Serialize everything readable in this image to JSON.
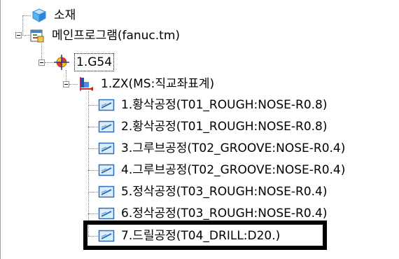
{
  "tree": {
    "material": {
      "label": "소재",
      "icon": "material-cube-icon"
    },
    "main_program": {
      "label": "메인프로그램(fanuc.tm)",
      "icon": "program-icon"
    },
    "workpiece_origin": {
      "label": "1.G54",
      "icon": "origin-target-icon"
    },
    "coordinate_system": {
      "label": "1.ZX(MS:직교좌표계)",
      "icon": "coordinate-system-icon"
    },
    "operations": [
      {
        "label": "1.황삭공정(T01_ROUGH:NOSE-R0.8)",
        "icon": "operation-icon"
      },
      {
        "label": "2.황삭공정(T01_ROUGH:NOSE-R0.8)",
        "icon": "operation-icon"
      },
      {
        "label": "3.그루브공정(T02_GROOVE:NOSE-R0.4)",
        "icon": "operation-icon"
      },
      {
        "label": "4.그루브공정(T02_GROOVE:NOSE-R0.4)",
        "icon": "operation-icon"
      },
      {
        "label": "5.정삭공정(T03_ROUGH:NOSE-R0.4)",
        "icon": "operation-icon"
      },
      {
        "label": "6.정삭공정(T03_ROUGH:NOSE-R0.4)",
        "icon": "operation-icon"
      },
      {
        "label": "7.드릴공정(T04_DRILL:D20.)",
        "icon": "operation-icon"
      }
    ]
  },
  "colors": {
    "highlight_border": "#000000",
    "tree_lines": "#808080"
  }
}
